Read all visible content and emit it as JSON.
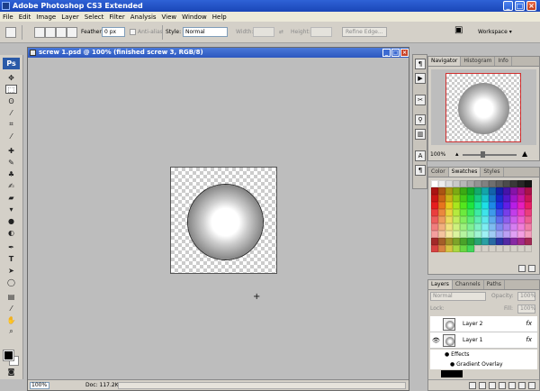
{
  "window": {
    "title": "Adobe Photoshop CS3 Extended"
  },
  "menu": [
    "File",
    "Edit",
    "Image",
    "Layer",
    "Select",
    "Filter",
    "Analysis",
    "View",
    "Window",
    "Help"
  ],
  "options": {
    "feather_label": "Feather:",
    "feather_value": "0 px",
    "antialias_label": "Anti-alias",
    "style_label": "Style:",
    "style_value": "Normal",
    "width_label": "Width:",
    "height_label": "Height:",
    "refine_label": "Refine Edge...",
    "workspace_label": "Workspace ▾"
  },
  "document": {
    "title": "screw 1.psd @ 100% (finished screw 3, RGB/8)",
    "zoom": "100%",
    "doc_info": "Doc: 117.2K/1.07M"
  },
  "navigator": {
    "tabs": [
      "Navigator",
      "Histogram",
      "Info"
    ],
    "zoom": "100%"
  },
  "color_panel": {
    "tabs": [
      "Color",
      "Swatches",
      "Styles"
    ]
  },
  "layers_panel": {
    "tabs": [
      "Layers",
      "Channels",
      "Paths"
    ],
    "blend_mode": "Normal",
    "opacity_label": "Opacity:",
    "opacity_value": "100%",
    "lock_label": "Lock:",
    "fill_label": "Fill:",
    "fill_value": "100%",
    "layers": [
      {
        "name": "Layer 2",
        "fx": "fx"
      },
      {
        "name": "Layer 1",
        "fx": "fx"
      }
    ],
    "effects_label": "Effects",
    "effect_item": "Gradient Overlay"
  },
  "icons": {
    "window": [
      "photoshop-icon",
      "minimize-icon",
      "maximize-icon",
      "close-icon"
    ],
    "tools": [
      "move-icon",
      "marquee-icon",
      "lasso-icon",
      "magic-wand-icon",
      "crop-icon",
      "slice-icon",
      "healing-icon",
      "brush-icon",
      "stamp-icon",
      "history-brush-icon",
      "eraser-icon",
      "bucket-icon",
      "blur-icon",
      "dodge-icon",
      "pen-icon",
      "type-icon",
      "path-select-icon",
      "shape-icon",
      "notes-icon",
      "eyedropper-icon",
      "hand-icon",
      "zoom-icon"
    ]
  },
  "colors": {
    "foreground": "#000000",
    "background": "#ffffff",
    "title_blue": "#2f62d6"
  }
}
